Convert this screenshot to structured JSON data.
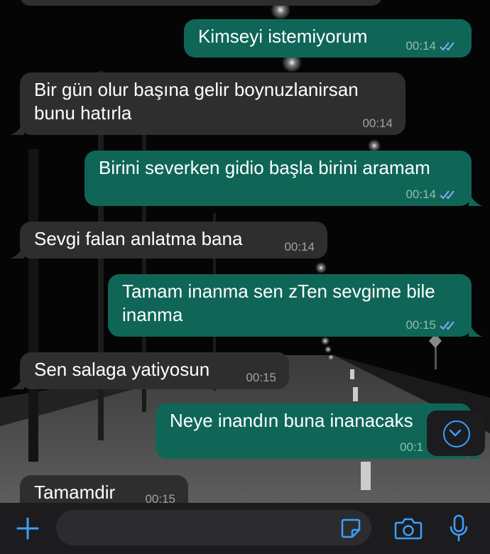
{
  "messages": [
    {
      "dir": "out",
      "text": "Kimseyi istemiyorum",
      "time": "00:14",
      "ticks": "read"
    },
    {
      "dir": "in",
      "lines": [
        "Bir gün olur başına gelir boynuzlanirsan",
        "bunu hatırla"
      ],
      "time": "00:14"
    },
    {
      "dir": "out",
      "text": "Birini severken gidio başla birini aramam",
      "time": "00:14",
      "ticks": "read"
    },
    {
      "dir": "in",
      "text": "Sevgi falan anlatma bana",
      "time": "00:14"
    },
    {
      "dir": "out",
      "lines": [
        "Tamam inanma sen zTen sevgime bile",
        "inanma"
      ],
      "time": "00:15",
      "ticks": "read"
    },
    {
      "dir": "in",
      "text": "Sen salaga yatiyosun",
      "time": "00:15"
    },
    {
      "dir": "out",
      "text": "Neye inandın buna inanacaks",
      "time": "00:1"
    },
    {
      "dir": "in",
      "text": "Tamamdir",
      "time": "00:15"
    }
  ],
  "composer": {
    "placeholder": "",
    "icons": [
      "plus-icon",
      "sticker-icon",
      "camera-icon",
      "microphone-icon"
    ]
  },
  "scroll_button": {
    "icon": "chevron-down-icon"
  },
  "colors": {
    "incoming": "#2e2e2f",
    "outgoing": "#0f6656",
    "accent": "#3aa0ff",
    "bar": "#1c1c1e"
  }
}
